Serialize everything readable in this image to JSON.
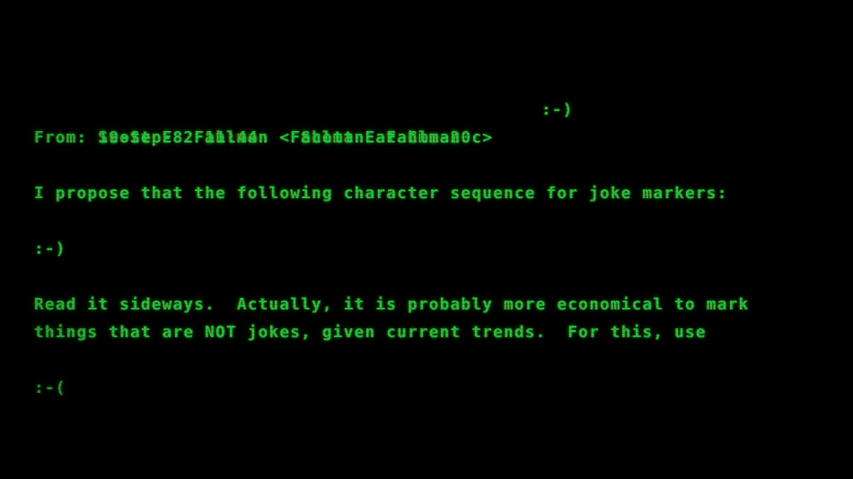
{
  "terminal": {
    "theme": {
      "background": "#000000",
      "foreground": "#22c93a",
      "fringe_red": "#960a0a",
      "glow": "#1ebe3c"
    },
    "header": {
      "timestamp": "19-Sep-82 11:44",
      "sender": "Scott E Fahlman",
      "trailing_marker": ":-)",
      "header_line": "19-Sep-82 11:44    Scott E Fahlman",
      "from_line": "From: Scott E  Fahlman <Fahlman at Cmu-20c>"
    },
    "body_lines": [
      "I propose that the following character sequence for joke markers:",
      "",
      ":-)",
      "",
      "Read it sideways.  Actually, it is probably more economical to mark",
      "things that are NOT jokes, given current trends.  For this, use",
      "",
      ":-("
    ],
    "markers": {
      "joke": ":-)",
      "not_joke": ":-("
    }
  }
}
